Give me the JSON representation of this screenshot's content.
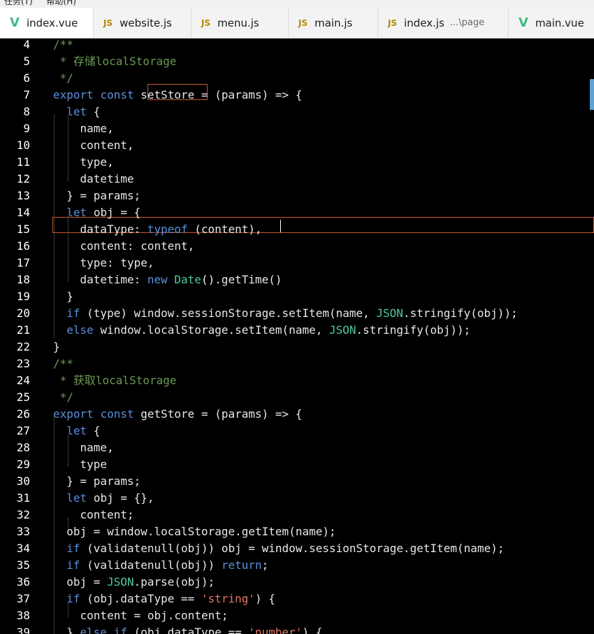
{
  "menubar": {
    "items": [
      "任务(T)",
      "帮助(H)"
    ]
  },
  "tabs": [
    {
      "icon": "vue-icon",
      "label": "index.vue",
      "path": "",
      "active": true
    },
    {
      "icon": "js-icon",
      "label": "website.js",
      "path": "",
      "active": false
    },
    {
      "icon": "js-icon",
      "label": "menu.js",
      "path": "",
      "active": false
    },
    {
      "icon": "js-icon",
      "label": "main.js",
      "path": "",
      "active": false
    },
    {
      "icon": "js-icon",
      "label": "index.js",
      "path": "...\\page",
      "active": false
    },
    {
      "icon": "vue-icon",
      "label": "main.vue",
      "path": "",
      "active": false
    }
  ],
  "icon_text": {
    "js": "JS",
    "vue": "V"
  },
  "editor": {
    "lines": [
      {
        "n": "4",
        "t": "/**"
      },
      {
        "n": "5",
        "t": " * 存储localStorage"
      },
      {
        "n": "6",
        "t": " */"
      },
      {
        "n": "7",
        "t": "export const setStore = (params) => {"
      },
      {
        "n": "8",
        "t": "  let {"
      },
      {
        "n": "9",
        "t": "    name,"
      },
      {
        "n": "10",
        "t": "    content,"
      },
      {
        "n": "11",
        "t": "    type,"
      },
      {
        "n": "12",
        "t": "    datetime"
      },
      {
        "n": "13",
        "t": "  } = params;"
      },
      {
        "n": "14",
        "t": "  let obj = {"
      },
      {
        "n": "15",
        "t": "    dataType: typeof (content),"
      },
      {
        "n": "16",
        "t": "    content: content,"
      },
      {
        "n": "17",
        "t": "    type: type,"
      },
      {
        "n": "18",
        "t": "    datetime: new Date().getTime()"
      },
      {
        "n": "19",
        "t": "  }"
      },
      {
        "n": "20",
        "t": "  if (type) window.sessionStorage.setItem(name, JSON.stringify(obj));"
      },
      {
        "n": "21",
        "t": "  else window.localStorage.setItem(name, JSON.stringify(obj));"
      },
      {
        "n": "22",
        "t": "}"
      },
      {
        "n": "23",
        "t": "/**"
      },
      {
        "n": "24",
        "t": " * 获取localStorage"
      },
      {
        "n": "25",
        "t": " */"
      },
      {
        "n": "26",
        "t": "export const getStore = (params) => {"
      },
      {
        "n": "27",
        "t": "  let {"
      },
      {
        "n": "28",
        "t": "    name,"
      },
      {
        "n": "29",
        "t": "    type"
      },
      {
        "n": "30",
        "t": "  } = params;"
      },
      {
        "n": "31",
        "t": "  let obj = {},"
      },
      {
        "n": "32",
        "t": "    content;"
      },
      {
        "n": "33",
        "t": "  obj = window.localStorage.getItem(name);"
      },
      {
        "n": "34",
        "t": "  if (validatenull(obj)) obj = window.sessionStorage.getItem(name);"
      },
      {
        "n": "35",
        "t": "  if (validatenull(obj)) return;"
      },
      {
        "n": "36",
        "t": "  obj = JSON.parse(obj);"
      },
      {
        "n": "37",
        "t": "  if (obj.dataType == 'string') {"
      },
      {
        "n": "38",
        "t": "    content = obj.content;"
      },
      {
        "n": "39",
        "t": "  } else if (obj.dataType == 'number') {"
      }
    ]
  }
}
